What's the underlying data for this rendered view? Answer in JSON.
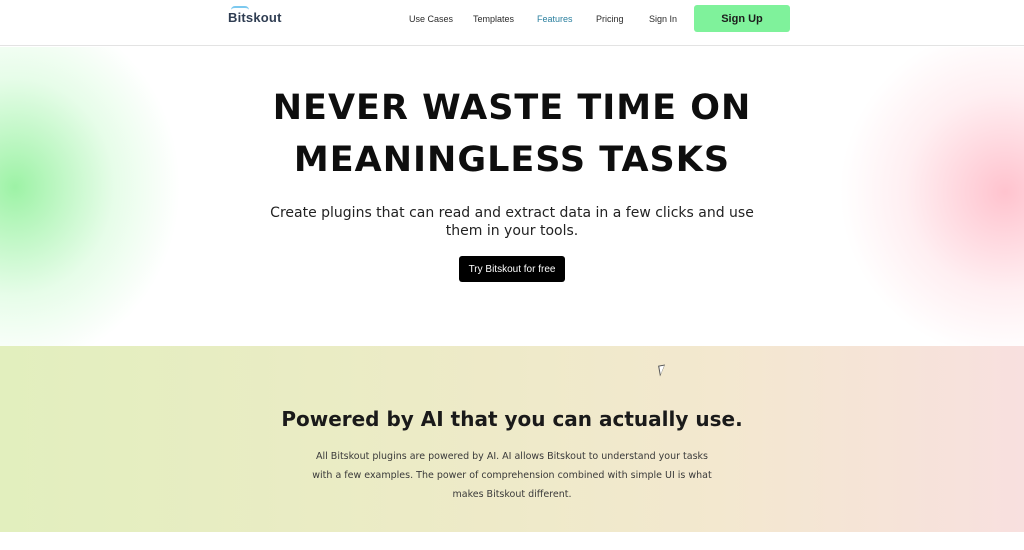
{
  "nav": {
    "logo": "Bitskout",
    "links": [
      {
        "label": "Use Cases",
        "active": false
      },
      {
        "label": "Templates",
        "active": false
      },
      {
        "label": "Features",
        "active": true
      },
      {
        "label": "Pricing",
        "active": false
      },
      {
        "label": "Sign In",
        "active": false
      }
    ],
    "signup_label": "Sign Up"
  },
  "hero": {
    "title_line1": "NEVER WASTE TIME ON",
    "title_line2": "MEANINGLESS TASKS",
    "subtitle": "Create plugins that can read and extract data in a few clicks and use them in your tools.",
    "cta_label": "Try Bitskout for free"
  },
  "ai_section": {
    "title": "Powered by AI that you can actually use.",
    "text": "All Bitskout plugins are powered by AI. AI allows Bitskout to understand your tasks with a few examples. The power of comprehension combined with simple UI is what makes Bitskout different."
  },
  "colors": {
    "accent_green": "#7ff29b",
    "active_link": "#2a7f9e",
    "cta_background": "#000000"
  }
}
